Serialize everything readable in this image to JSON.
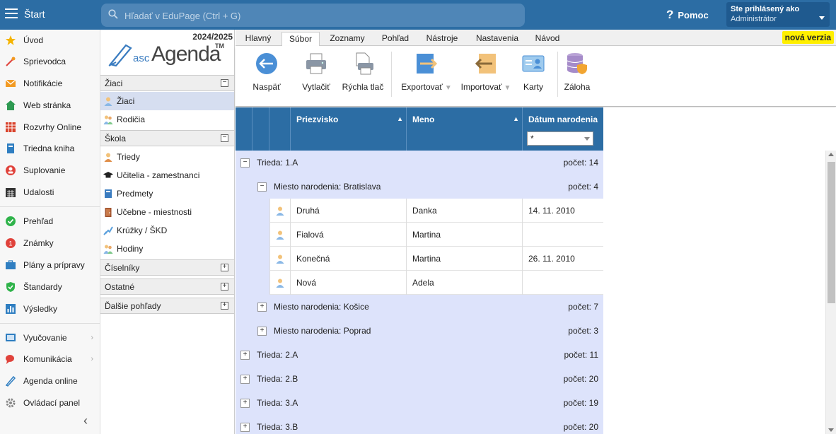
{
  "topbar": {
    "start_label": "Štart",
    "search_placeholder": "Hľadať v EduPage (Ctrl + G)",
    "help_label": "Pomoc",
    "user_line1": "Ste prihlásený ako",
    "user_line2": "Administrátor"
  },
  "leftnav": {
    "items": [
      {
        "label": "Úvod",
        "icon": "star-icon",
        "color": "#f5b400"
      },
      {
        "label": "Sprievodca",
        "icon": "wand-icon",
        "color": "#e0423b"
      },
      {
        "label": "Notifikácie",
        "icon": "envelope-icon",
        "color": "#f29a22"
      },
      {
        "label": "Web stránka",
        "icon": "home-icon",
        "color": "#2e9a52"
      },
      {
        "label": "Rozvrhy Online",
        "icon": "timetable-icon",
        "color": "#d9432c"
      },
      {
        "label": "Triedna kniha",
        "icon": "book-icon",
        "color": "#2f7ec1"
      },
      {
        "label": "Suplovanie",
        "icon": "substitution-icon",
        "color": "#e0423b"
      },
      {
        "label": "Udalosti",
        "icon": "calendar-icon",
        "color": "#333333"
      },
      {
        "label": "Prehľad",
        "icon": "check-circle-icon",
        "color": "#2fb34a"
      },
      {
        "label": "Známky",
        "icon": "grades-icon",
        "color": "#e0423b"
      },
      {
        "label": "Plány a prípravy",
        "icon": "briefcase-icon",
        "color": "#2f7ec1"
      },
      {
        "label": "Štandardy",
        "icon": "shield-check-icon",
        "color": "#2fb34a"
      },
      {
        "label": "Výsledky",
        "icon": "bar-chart-icon",
        "color": "#2f7ec1"
      },
      {
        "label": "Vyučovanie",
        "icon": "teaching-icon",
        "color": "#2f7ec1"
      },
      {
        "label": "Komunikácia",
        "icon": "chat-icon",
        "color": "#e0423b"
      },
      {
        "label": "Agenda online",
        "icon": "agenda-icon",
        "color": "#2f7ec1"
      },
      {
        "label": "Ovládací panel",
        "icon": "gear-icon",
        "color": "#888888"
      }
    ]
  },
  "agenda": {
    "year": "2024/2025",
    "logo_asc": "asc",
    "logo_agenda": "Agenda",
    "logo_tm": "TM",
    "sections": [
      {
        "title": "Žiaci",
        "toggle": "−",
        "items": [
          "Žiaci",
          "Rodičia"
        ]
      },
      {
        "title": "Škola",
        "toggle": "−",
        "items": [
          "Triedy",
          "Učitelia - zamestnanci",
          "Predmety",
          "Učebne - miestnosti",
          "Krúžky / ŠKD",
          "Hodiny"
        ]
      },
      {
        "title": "Číselníky",
        "toggle": "+",
        "items": []
      },
      {
        "title": "Ostatné",
        "toggle": "+",
        "items": []
      },
      {
        "title": "Ďalšie pohľady",
        "toggle": "+",
        "items": []
      }
    ]
  },
  "tabs": [
    "Hlavný",
    "Súbor",
    "Zoznamy",
    "Pohľad",
    "Nástroje",
    "Nastavenia",
    "Návod"
  ],
  "active_tab": "Súbor",
  "nova_verzia": "nová verzia",
  "ribbon": {
    "back": "Naspäť",
    "print": "Vytlačiť",
    "quick_print": "Rýchla tlač",
    "export": "Exportovať",
    "import": "Importovať",
    "cards": "Karty",
    "backup": "Záloha"
  },
  "grid": {
    "columns": [
      "Priezvisko",
      "Meno",
      "Dátum narodenia"
    ],
    "filter_value": "*",
    "groups": [
      {
        "label": "Trieda: 1.A",
        "count": "počet: 14",
        "toggle": "−"
      },
      {
        "label": "Miesto narodenia: Bratislava",
        "count": "počet: 4",
        "toggle": "−"
      },
      {
        "label": "Miesto narodenia: Košice",
        "count": "počet: 7",
        "toggle": "+"
      },
      {
        "label": "Miesto narodenia: Poprad",
        "count": "počet: 3",
        "toggle": "+"
      },
      {
        "label": "Trieda: 2.A",
        "count": "počet: 11",
        "toggle": "+"
      },
      {
        "label": "Trieda: 2.B",
        "count": "počet: 20",
        "toggle": "+"
      },
      {
        "label": "Trieda: 3.A",
        "count": "počet: 19",
        "toggle": "+"
      },
      {
        "label": "Trieda: 3.B",
        "count": "počet: 20",
        "toggle": "+"
      }
    ],
    "rows": [
      {
        "surname": "Druhá",
        "name": "Danka",
        "birth": "14. 11. 2010"
      },
      {
        "surname": "Fialová",
        "name": "Martina",
        "birth": ""
      },
      {
        "surname": "Konečná",
        "name": "Martina",
        "birth": "26. 11. 2010"
      },
      {
        "surname": "Nová",
        "name": "Adela",
        "birth": ""
      }
    ]
  }
}
